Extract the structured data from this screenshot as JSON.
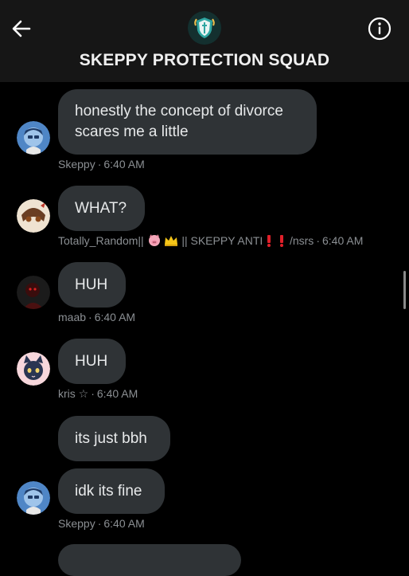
{
  "header": {
    "title": "SKEPPY PROTECTION SQUAD",
    "back_icon": "arrow-left-icon",
    "info_icon": "info-circle-icon"
  },
  "messages": [
    {
      "text_line1": "honestly the concept of divorce",
      "text_line2": "scares me a little",
      "sender": "Skeppy",
      "time": "6:40 AM"
    },
    {
      "text": "WHAT?",
      "sender_prefix": "Totally_Random||",
      "sender_mid": "|| SKEPPY ANTI",
      "sender_suffix": "/nsrs",
      "time": "6:40 AM"
    },
    {
      "text": "HUH",
      "sender": "maab",
      "time": "6:40 AM"
    },
    {
      "text": "HUH",
      "sender": "kris ☆",
      "time": "6:40 AM"
    },
    {
      "text": "its just bbh"
    },
    {
      "text": "idk its fine",
      "sender": "Skeppy",
      "time": "6:40 AM"
    }
  ],
  "colors": {
    "background": "#000000",
    "header_bg": "#161616",
    "bubble_bg": "#2f3336",
    "meta_text": "#8b8f93",
    "exclamation_red": "#e0202a"
  }
}
